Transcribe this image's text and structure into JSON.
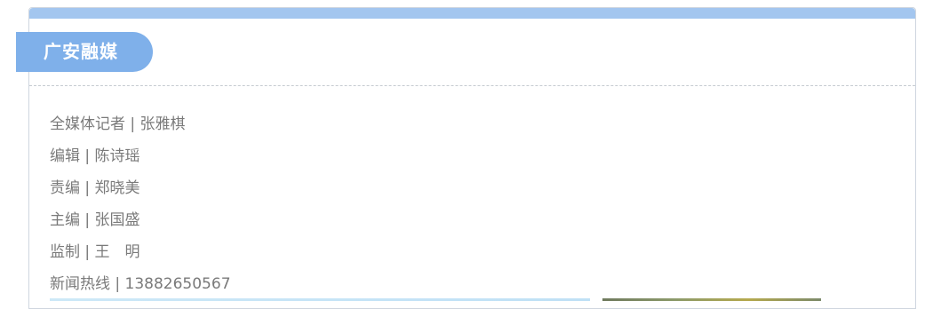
{
  "header": {
    "tag_label": "广安融媒"
  },
  "credits": [
    {
      "text": "全媒体记者 | 张雅棋"
    },
    {
      "text": "编辑 | 陈诗瑶"
    },
    {
      "text": "责编 | 郑晓美"
    },
    {
      "text": "主编 | 张国盛"
    },
    {
      "text": "监制 | 王　明"
    },
    {
      "text": "新闻热线 | 13882650567"
    }
  ]
}
